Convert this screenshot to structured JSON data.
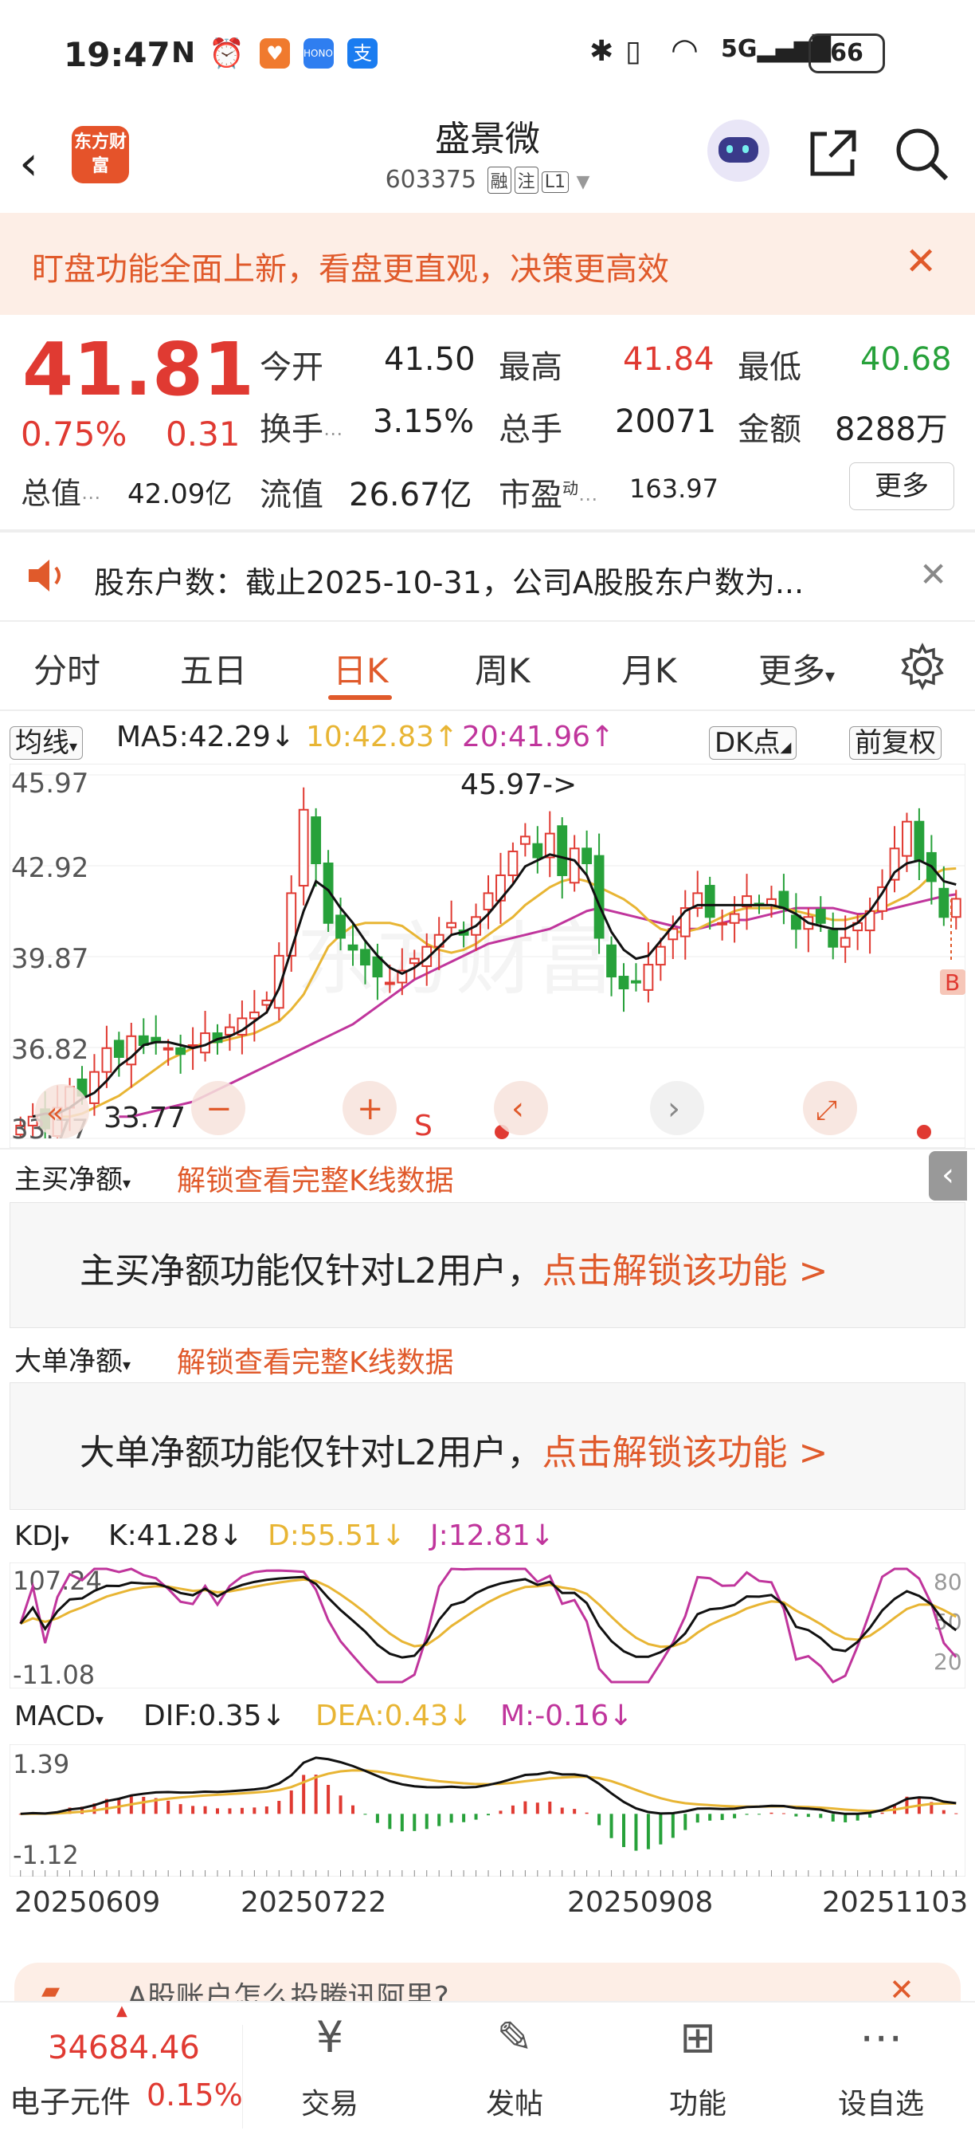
{
  "status": {
    "time": "19:47",
    "battery": "66"
  },
  "header": {
    "logo": "东方财富",
    "title": "盛景微",
    "code": "603375",
    "tags": [
      "融",
      "注",
      "L1"
    ]
  },
  "banner": {
    "text": "盯盘功能全面上新，看盘更直观，决策更高效"
  },
  "quote": {
    "price": "41.81",
    "pct": "0.75%",
    "chg": "0.31",
    "open_label": "今开",
    "open": "41.50",
    "high_label": "最高",
    "high": "41.84",
    "low_label": "最低",
    "low": "40.68",
    "turnover_label": "换手",
    "turnover": "3.15%",
    "vol_label": "总手",
    "vol": "20071",
    "amount_label": "金额",
    "amount": "8288万",
    "mcap_label": "总值",
    "mcap": "42.09亿",
    "float_label": "流值",
    "float": "26.67亿",
    "pe_label": "市盈",
    "pe_sup": "动",
    "pe": "163.97",
    "more": "更多"
  },
  "notice": {
    "text": "股东户数：截止2025-10-31，公司A股股东户数为..."
  },
  "tabs": [
    "分时",
    "五日",
    "日K",
    "周K",
    "月K",
    "更多"
  ],
  "active_tab": "日K",
  "kline": {
    "ma_select": "均线",
    "ma5": "MA5:42.29↓",
    "ma10": "10:42.83↑",
    "ma20": "20:41.96↑",
    "dk": "DK点",
    "adjust": "前复权",
    "y_labels": [
      "45.97",
      "42.92",
      "39.87",
      "36.82",
      "33.77"
    ],
    "max_label": "45.97->",
    "min_label": "33.77",
    "b_mark": "B",
    "s_mark": "S"
  },
  "panel1": {
    "select": "主买净额",
    "unlock": "解锁查看完整K线数据",
    "msg": "主买净额功能仅针对L2用户，",
    "link": "点击解锁该功能 >"
  },
  "panel2": {
    "select": "大单净额",
    "unlock": "解锁查看完整K线数据",
    "msg": "大单净额功能仅针对L2用户，",
    "link": "点击解锁该功能 >"
  },
  "kdj": {
    "select": "KDJ",
    "k": "K:41.28↓",
    "d": "D:55.51↓",
    "j": "J:12.81↓",
    "top": "107.24",
    "bottom": "-11.08",
    "r1": "80",
    "r2": "50",
    "r3": "20"
  },
  "macd": {
    "select": "MACD",
    "dif": "DIF:0.35↓",
    "dea": "DEA:0.43↓",
    "m": "M:-0.16↓",
    "top": "1.39",
    "bottom": "-1.12"
  },
  "dates": [
    "20250609",
    "20250722",
    "20250908",
    "20251103"
  ],
  "ad": {
    "text": "A股账户怎么投腾讯阿里?"
  },
  "bottom": {
    "index_value": "34684.46",
    "index_name": "电子元件",
    "index_pct": "0.15%",
    "nav": [
      "交易",
      "发帖",
      "功能",
      "设自选"
    ]
  },
  "chart_data": {
    "type": "candlestick",
    "ylim": [
      33.77,
      45.97
    ],
    "close": [
      34.2,
      34.5,
      34.1,
      34.8,
      35.5,
      35.2,
      36.0,
      36.8,
      36.5,
      37.2,
      36.9,
      37.0,
      36.8,
      36.6,
      36.9,
      37.3,
      37.0,
      37.5,
      37.8,
      38.0,
      38.4,
      39.9,
      42.0,
      44.8,
      43.0,
      41.0,
      40.5,
      40.1,
      39.6,
      39.2,
      39.0,
      39.4,
      39.8,
      40.2,
      40.6,
      41.0,
      40.6,
      41.2,
      42.0,
      42.6,
      43.4,
      43.9,
      43.2,
      44.0,
      42.6,
      43.5,
      43.0,
      40.5,
      39.2,
      38.8,
      39.0,
      39.6,
      40.2,
      40.8,
      41.5,
      42.0,
      41.2,
      41.0,
      41.3,
      41.9,
      41.6,
      41.8,
      41.5,
      40.8,
      41.2,
      41.0,
      40.2,
      40.5,
      41.0,
      41.4,
      42.2,
      43.5,
      44.4,
      43.1,
      42.4,
      41.2,
      41.81
    ],
    "ma5": [
      34.5,
      34.6,
      34.6,
      34.8,
      35.1,
      35.3,
      35.7,
      36.2,
      36.5,
      36.9,
      37.0,
      37.0,
      36.9,
      36.8,
      36.9,
      37.1,
      37.2,
      37.4,
      37.7,
      38.0,
      38.8,
      40.1,
      41.4,
      42.4,
      42.1,
      41.5,
      41.0,
      40.4,
      39.9,
      39.5,
      39.3,
      39.5,
      39.8,
      40.2,
      40.6,
      40.7,
      40.9,
      41.3,
      41.8,
      42.3,
      42.9,
      43.1,
      43.3,
      43.2,
      43.1,
      42.6,
      41.6,
      40.7,
      40.1,
      39.8,
      39.9,
      40.4,
      40.9,
      41.4,
      41.6,
      41.6,
      41.6,
      41.6,
      41.6,
      41.6,
      41.6,
      41.5,
      41.3,
      41.0,
      40.9,
      40.8,
      40.8,
      41.0,
      41.4,
      42.0,
      42.7,
      43.0,
      43.1,
      42.9,
      42.4,
      42.29
    ],
    "ma10": [
      34.5,
      34.5,
      34.5,
      34.6,
      34.8,
      35.0,
      35.2,
      35.5,
      35.8,
      36.1,
      36.4,
      36.6,
      36.8,
      37.0,
      37.0,
      37.1,
      37.2,
      37.3,
      37.5,
      37.7,
      38.1,
      38.6,
      39.4,
      40.2,
      40.6,
      40.9,
      41.0,
      41.0,
      41.0,
      40.9,
      40.6,
      40.3,
      40.1,
      40.0,
      40.1,
      40.3,
      40.6,
      40.9,
      41.2,
      41.6,
      41.9,
      42.2,
      42.4,
      42.5,
      42.4,
      42.2,
      42.0,
      41.8,
      41.5,
      41.1,
      40.8,
      40.7,
      40.7,
      40.8,
      41.0,
      41.2,
      41.4,
      41.5,
      41.5,
      41.5,
      41.5,
      41.4,
      41.3,
      41.2,
      41.1,
      41.1,
      41.2,
      41.3,
      41.5,
      41.7,
      41.9,
      42.2,
      42.6,
      42.8,
      42.83
    ],
    "ma20": [
      34.5,
      34.5,
      34.6,
      34.7,
      34.8,
      34.9,
      35.0,
      35.2,
      35.4,
      35.6,
      35.8,
      36.0,
      36.2,
      36.4,
      36.6,
      36.8,
      37.0,
      37.2,
      37.4,
      37.6,
      37.9,
      38.2,
      38.5,
      38.8,
      39.1,
      39.3,
      39.5,
      39.7,
      39.9,
      40.1,
      40.3,
      40.4,
      40.5,
      40.6,
      40.7,
      40.8,
      41.0,
      41.2,
      41.4,
      41.5,
      41.4,
      41.3,
      41.2,
      41.1,
      41.0,
      40.9,
      40.8,
      40.8,
      40.9,
      41.0,
      41.1,
      41.1,
      41.2,
      41.3,
      41.4,
      41.5,
      41.5,
      41.5,
      41.5,
      41.4,
      41.3,
      41.3,
      41.4,
      41.5,
      41.6,
      41.7,
      41.8,
      41.9,
      41.96
    ]
  }
}
